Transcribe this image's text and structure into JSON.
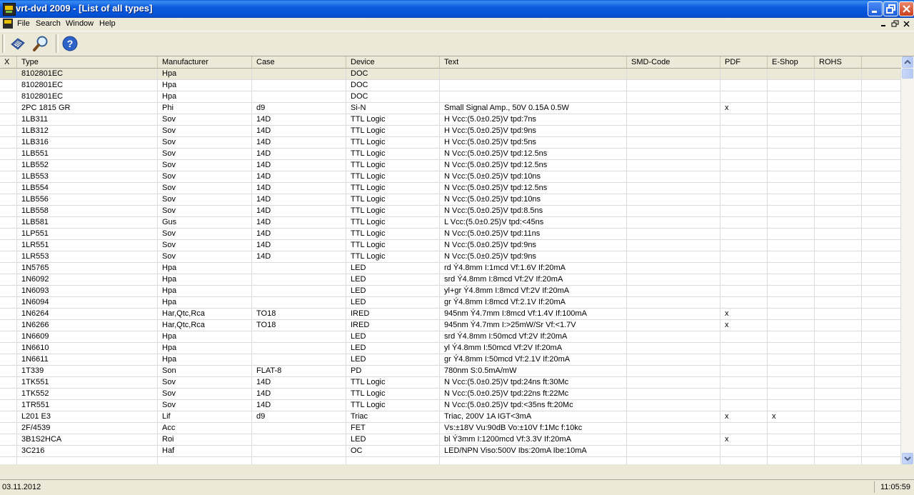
{
  "window": {
    "title": "vrt-dvd 2009 - [List of all types]"
  },
  "menu": [
    "File",
    "Search",
    "Window",
    "Help"
  ],
  "toolbar": {
    "icons": [
      "open-book-icon",
      "search-magnifier-icon",
      "help-icon"
    ]
  },
  "grid": {
    "columns": [
      "X",
      "Type",
      "Manufacturer",
      "Case",
      "Device",
      "Text",
      "SMD-Code",
      "PDF",
      "E-Shop",
      "ROHS"
    ],
    "rows": [
      [
        "",
        "8102801EC",
        "Hpa",
        "",
        "DOC",
        "",
        "",
        "",
        "",
        ""
      ],
      [
        "",
        "8102801EC",
        "Hpa",
        "",
        "DOC",
        "",
        "",
        "",
        "",
        ""
      ],
      [
        "",
        "8102801EC",
        "Hpa",
        "",
        "DOC",
        "",
        "",
        "",
        "",
        ""
      ],
      [
        "",
        "2PC 1815 GR",
        "Phi",
        "d9",
        "Si-N",
        "Small Signal Amp., 50V 0.15A 0.5W",
        "",
        "x",
        "",
        ""
      ],
      [
        "",
        "1LB311",
        "Sov",
        "14D",
        "TTL Logic",
        "H Vcc:(5.0±0.25)V tpd:7ns",
        "",
        "",
        "",
        ""
      ],
      [
        "",
        "1LB312",
        "Sov",
        "14D",
        "TTL Logic",
        "H Vcc:(5.0±0.25)V tpd:9ns",
        "",
        "",
        "",
        ""
      ],
      [
        "",
        "1LB316",
        "Sov",
        "14D",
        "TTL Logic",
        "H Vcc:(5.0±0.25)V tpd:5ns",
        "",
        "",
        "",
        ""
      ],
      [
        "",
        "1LB551",
        "Sov",
        "14D",
        "TTL Logic",
        "N Vcc:(5.0±0.25)V tpd:12.5ns",
        "",
        "",
        "",
        ""
      ],
      [
        "",
        "1LB552",
        "Sov",
        "14D",
        "TTL Logic",
        "N Vcc:(5.0±0.25)V tpd:12.5ns",
        "",
        "",
        "",
        ""
      ],
      [
        "",
        "1LB553",
        "Sov",
        "14D",
        "TTL Logic",
        "N Vcc:(5.0±0.25)V tpd:10ns",
        "",
        "",
        "",
        ""
      ],
      [
        "",
        "1LB554",
        "Sov",
        "14D",
        "TTL Logic",
        "N Vcc:(5.0±0.25)V tpd:12.5ns",
        "",
        "",
        "",
        ""
      ],
      [
        "",
        "1LB556",
        "Sov",
        "14D",
        "TTL Logic",
        "N Vcc:(5.0±0.25)V tpd:10ns",
        "",
        "",
        "",
        ""
      ],
      [
        "",
        "1LB558",
        "Sov",
        "14D",
        "TTL Logic",
        "N Vcc:(5.0±0.25)V tpd:8.5ns",
        "",
        "",
        "",
        ""
      ],
      [
        "",
        "1LB581",
        "Gus",
        "14D",
        "TTL Logic",
        "L Vcc:(5.0±0.25)V tpd:<45ns",
        "",
        "",
        "",
        ""
      ],
      [
        "",
        "1LP551",
        "Sov",
        "14D",
        "TTL Logic",
        "N Vcc:(5.0±0.25)V tpd:11ns",
        "",
        "",
        "",
        ""
      ],
      [
        "",
        "1LR551",
        "Sov",
        "14D",
        "TTL Logic",
        "N Vcc:(5.0±0.25)V tpd:9ns",
        "",
        "",
        "",
        ""
      ],
      [
        "",
        "1LR553",
        "Sov",
        "14D",
        "TTL Logic",
        "N Vcc:(5.0±0.25)V tpd:9ns",
        "",
        "",
        "",
        ""
      ],
      [
        "",
        "1N5765",
        "Hpa",
        "",
        "LED",
        "rd Ý4.8mm I:1mcd Vf:1.6V If:20mA",
        "",
        "",
        "",
        ""
      ],
      [
        "",
        "1N6092",
        "Hpa",
        "",
        "LED",
        "srd Ý4.8mm I:8mcd Vf:2V If:20mA",
        "",
        "",
        "",
        ""
      ],
      [
        "",
        "1N6093",
        "Hpa",
        "",
        "LED",
        "yl+gr Ý4.8mm I:8mcd Vf:2V If:20mA",
        "",
        "",
        "",
        ""
      ],
      [
        "",
        "1N6094",
        "Hpa",
        "",
        "LED",
        "gr Ý4.8mm I:8mcd Vf:2.1V If:20mA",
        "",
        "",
        "",
        ""
      ],
      [
        "",
        "1N6264",
        "Har,Qtc,Rca",
        "TO18",
        "IRED",
        "945nm Ý4.7mm I:8mcd Vf:1.4V If:100mA",
        "",
        "x",
        "",
        ""
      ],
      [
        "",
        "1N6266",
        "Har,Qtc,Rca",
        "TO18",
        "IRED",
        "945nm Ý4.7mm I:>25mW/Sr Vf:<1.7V",
        "",
        "x",
        "",
        ""
      ],
      [
        "",
        "1N6609",
        "Hpa",
        "",
        "LED",
        "srd Ý4.8mm I:50mcd Vf:2V If:20mA",
        "",
        "",
        "",
        ""
      ],
      [
        "",
        "1N6610",
        "Hpa",
        "",
        "LED",
        "yl Ý4.8mm I:50mcd Vf:2V If:20mA",
        "",
        "",
        "",
        ""
      ],
      [
        "",
        "1N6611",
        "Hpa",
        "",
        "LED",
        "gr Ý4.8mm I:50mcd Vf:2.1V If:20mA",
        "",
        "",
        "",
        ""
      ],
      [
        "",
        "1T339",
        "Son",
        "FLAT-8",
        "PD",
        "780nm S:0.5mA/mW",
        "",
        "",
        "",
        ""
      ],
      [
        "",
        "1TK551",
        "Sov",
        "14D",
        "TTL Logic",
        "N Vcc:(5.0±0.25)V tpd:24ns ft:30Mc",
        "",
        "",
        "",
        ""
      ],
      [
        "",
        "1TK552",
        "Sov",
        "14D",
        "TTL Logic",
        "N Vcc:(5.0±0.25)V tpd:22ns ft:22Mc",
        "",
        "",
        "",
        ""
      ],
      [
        "",
        "1TR551",
        "Sov",
        "14D",
        "TTL Logic",
        "N Vcc:(5.0±0.25)V tpd:<35ns ft:20Mc",
        "",
        "",
        "",
        ""
      ],
      [
        "",
        "L201 E3",
        "Lif",
        "d9",
        "Triac",
        "Triac, 200V 1A IGT<3mA",
        "",
        "x",
        "x",
        ""
      ],
      [
        "",
        "2F/4539",
        "Acc",
        "",
        "FET",
        "Vs:±18V Vu:90dB Vo:±10V f:1Mc f:10kc",
        "",
        "",
        "",
        ""
      ],
      [
        "",
        "3B1S2HCA",
        "Roi",
        "",
        "LED",
        "bl Ý3mm I:1200mcd Vf:3.3V If:20mA",
        "",
        "x",
        "",
        ""
      ],
      [
        "",
        "3C216",
        "Haf",
        "",
        "OC",
        "LED/NPN Viso:500V Ibs:20mA Ibe:10mA",
        "",
        "",
        "",
        ""
      ],
      [
        "",
        "",
        "",
        "",
        "",
        "",
        "",
        "",
        "",
        ""
      ]
    ]
  },
  "status": {
    "date": "03.11.2012",
    "time": "11:05:59"
  }
}
